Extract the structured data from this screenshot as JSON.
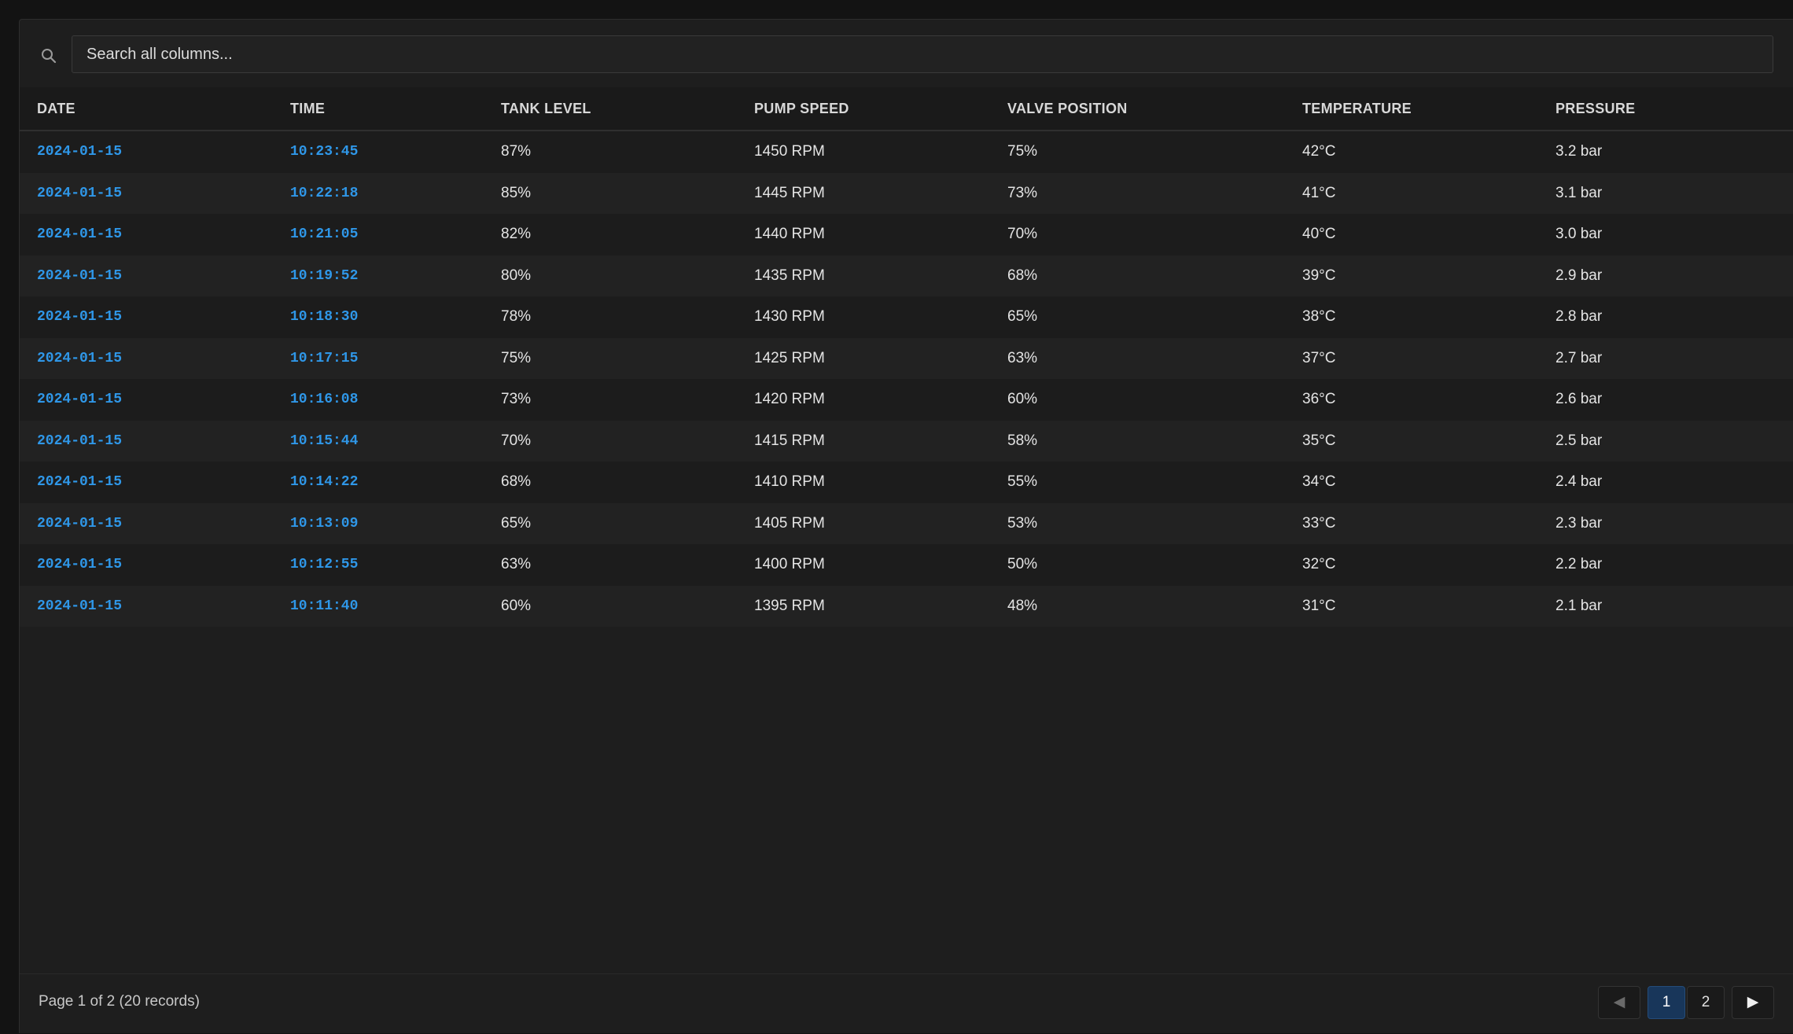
{
  "search": {
    "placeholder": "Search all columns..."
  },
  "table": {
    "columns": [
      "DATE",
      "TIME",
      "TANK LEVEL",
      "PUMP SPEED",
      "VALVE POSITION",
      "TEMPERATURE",
      "PRESSURE"
    ],
    "rows": [
      [
        "2024-01-15",
        "10:23:45",
        "87%",
        "1450 RPM",
        "75%",
        "42°C",
        "3.2 bar"
      ],
      [
        "2024-01-15",
        "10:22:18",
        "85%",
        "1445 RPM",
        "73%",
        "41°C",
        "3.1 bar"
      ],
      [
        "2024-01-15",
        "10:21:05",
        "82%",
        "1440 RPM",
        "70%",
        "40°C",
        "3.0 bar"
      ],
      [
        "2024-01-15",
        "10:19:52",
        "80%",
        "1435 RPM",
        "68%",
        "39°C",
        "2.9 bar"
      ],
      [
        "2024-01-15",
        "10:18:30",
        "78%",
        "1430 RPM",
        "65%",
        "38°C",
        "2.8 bar"
      ],
      [
        "2024-01-15",
        "10:17:15",
        "75%",
        "1425 RPM",
        "63%",
        "37°C",
        "2.7 bar"
      ],
      [
        "2024-01-15",
        "10:16:08",
        "73%",
        "1420 RPM",
        "60%",
        "36°C",
        "2.6 bar"
      ],
      [
        "2024-01-15",
        "10:15:44",
        "70%",
        "1415 RPM",
        "58%",
        "35°C",
        "2.5 bar"
      ],
      [
        "2024-01-15",
        "10:14:22",
        "68%",
        "1410 RPM",
        "55%",
        "34°C",
        "2.4 bar"
      ],
      [
        "2024-01-15",
        "10:13:09",
        "65%",
        "1405 RPM",
        "53%",
        "33°C",
        "2.3 bar"
      ],
      [
        "2024-01-15",
        "10:12:55",
        "63%",
        "1400 RPM",
        "50%",
        "32°C",
        "2.2 bar"
      ],
      [
        "2024-01-15",
        "10:11:40",
        "60%",
        "1395 RPM",
        "48%",
        "31°C",
        "2.1 bar"
      ]
    ]
  },
  "footer": {
    "page_info": "Page 1 of 2 (20 records)",
    "prev_icon": "chevron-left-icon",
    "next_icon": "chevron-right-icon",
    "prev_glyph": "◀",
    "next_glyph": "▶",
    "pages": [
      "1",
      "2"
    ],
    "current_page": "1"
  },
  "colors": {
    "background": "#131313",
    "panel": "#1e1e1e",
    "link": "#2f97e8",
    "active_page": "#18365a"
  }
}
